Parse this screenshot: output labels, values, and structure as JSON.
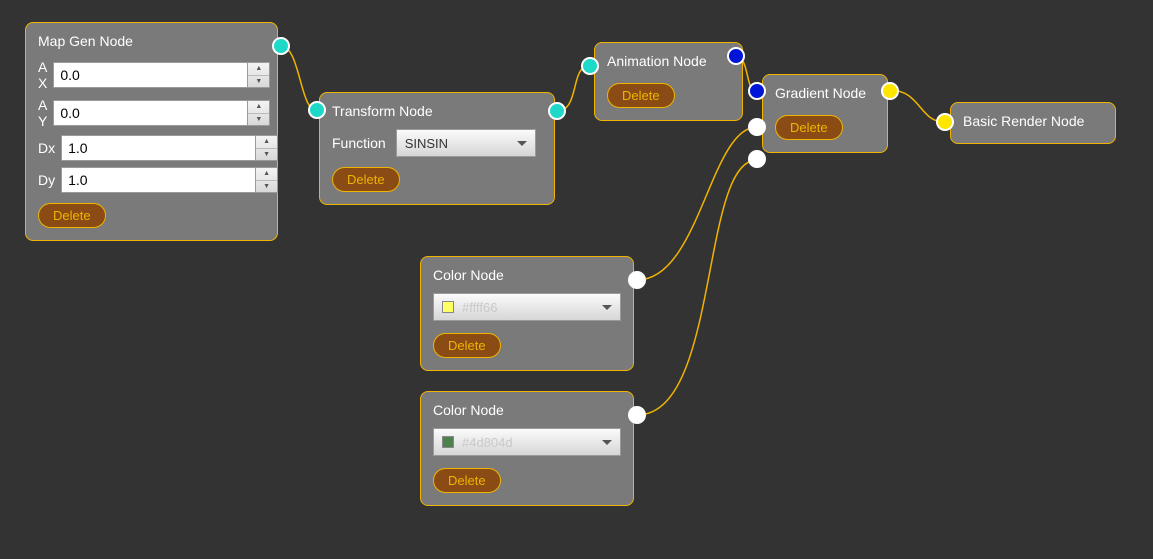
{
  "colors": {
    "node_border": "#f0b400",
    "node_bg": "#7a7a7a",
    "delete_bg": "#8a4b14",
    "delete_fg": "#f0b400",
    "port_cyan": "#1ed9c8",
    "port_yellow": "#ffe600",
    "port_blue": "#0015d8",
    "wire": "#f0b400"
  },
  "nodes": {
    "mapgen": {
      "title": "Map Gen Node",
      "fields": {
        "ax_label": "A X",
        "ax_value": "0.0",
        "ay_label": "A Y",
        "ay_value": "0.0",
        "dx_label": "Dx",
        "dx_value": "1.0",
        "dy_label": "Dy",
        "dy_value": "1.0"
      },
      "delete_label": "Delete"
    },
    "transform": {
      "title": "Transform Node",
      "function_label": "Function",
      "function_value": "SINSIN",
      "delete_label": "Delete"
    },
    "animation": {
      "title": "Animation Node",
      "delete_label": "Delete"
    },
    "gradient": {
      "title": "Gradient Node",
      "delete_label": "Delete"
    },
    "render": {
      "title": "Basic Render Node"
    },
    "color1": {
      "title": "Color Node",
      "swatch_hex": "#ffff66",
      "value_label": "#ffff66",
      "delete_label": "Delete"
    },
    "color2": {
      "title": "Color Node",
      "swatch_hex": "#4d804d",
      "value_label": "#4d804d",
      "delete_label": "Delete"
    }
  }
}
